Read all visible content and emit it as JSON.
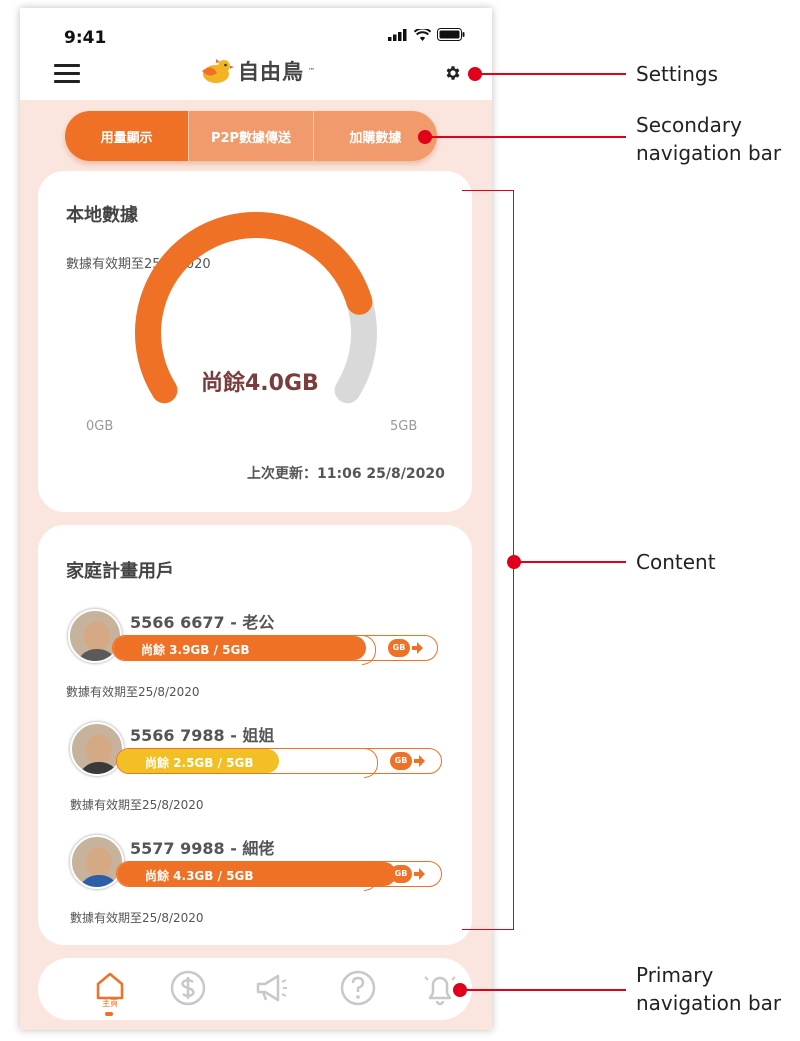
{
  "status": {
    "time": "9:41"
  },
  "header": {
    "logo_text": "自由鳥",
    "logo_tm": "™"
  },
  "secondary_nav": {
    "tabs": [
      {
        "label": "用量顯示"
      },
      {
        "label": "P2P數據傳送"
      },
      {
        "label": "加購數據"
      }
    ]
  },
  "local_data": {
    "title": "本地數據",
    "expiry": "數據有效期至25/8/2020",
    "remaining_label": "尚餘4.0GB",
    "remaining_gb": 4.0,
    "total_gb": 5,
    "min_label": "0GB",
    "max_label": "5GB",
    "last_update": "上次更新：11:06 25/8/2020"
  },
  "family": {
    "title": "家庭計畫用戶",
    "members": [
      {
        "name": "5566 6677 - 老公",
        "usage_text": "尚餘 3.9GB / 5GB",
        "fraction": 0.78,
        "color": "#ef7126",
        "expiry": "數據有效期至25/8/2020",
        "badge": "GB"
      },
      {
        "name": "5566 7988 - 姐姐",
        "usage_text": "尚餘 2.5GB / 5GB",
        "fraction": 0.5,
        "color": "#f2c024",
        "expiry": "數據有效期至25/8/2020",
        "badge": "GB"
      },
      {
        "name": "5577 9988 - 細佬",
        "usage_text": "尚餘 4.3GB / 5GB",
        "fraction": 0.86,
        "color": "#ef7126",
        "expiry": "數據有效期至25/8/2020",
        "badge": "GB"
      }
    ]
  },
  "bottom_nav": {
    "home_label": "主頁"
  },
  "annotations": {
    "settings": "Settings",
    "secondary": "Secondary navigation bar",
    "content": "Content",
    "primary": "Primary navigation bar"
  },
  "colors": {
    "accent": "#ef7126",
    "accent_light": "#f19a6b",
    "annotation": "#e0001b",
    "background": "#fbe6df"
  }
}
